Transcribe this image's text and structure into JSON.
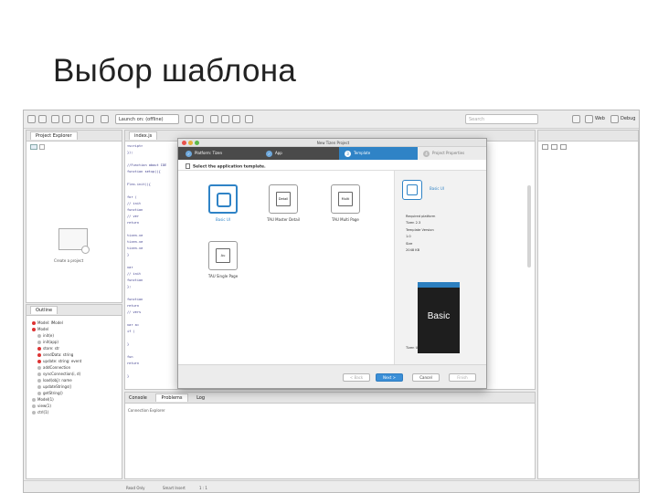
{
  "slide": {
    "title": "Выбор шаблона"
  },
  "toolbar": {
    "config_select": "Launch on: (offline)",
    "search_placeholder": "Search",
    "perspective_web": "Web",
    "perspective_debug": "Debug"
  },
  "left_panel": {
    "tab": "Project Explorer",
    "empty_label": "Create a project"
  },
  "editor": {
    "tab": "index.js",
    "lines": [
      "<script>",
      "  });",
      "",
      "//Function about IDE",
      "  function setup(){",
      "",
      "  Flex.init(){",
      "",
      "    for (",
      "      // init",
      "    function",
      "    // ver",
      "    return",
      "",
      "    tizen.ve",
      "    tizen.ve",
      "    tizen.ve",
      "  }",
      "",
      "  var",
      "    // init",
      "    function",
      "  };",
      "",
      "  function",
      "    return",
      "    // vers",
      "",
      "  var a=",
      "    if (",
      "",
      "  }",
      "",
      "  fun",
      "    return",
      "",
      "}"
    ]
  },
  "outline": {
    "tab": "Outline",
    "items": [
      {
        "label": "Model: IModel",
        "color": "#d33"
      },
      {
        "label": "Model",
        "color": "#d33"
      },
      {
        "label": "init(e)",
        "color": "#888"
      },
      {
        "label": "init(app)",
        "color": "#888"
      },
      {
        "label": "store: str",
        "color": "#d33"
      },
      {
        "label": "sendData: string",
        "color": "#d33"
      },
      {
        "label": "update: string: event",
        "color": "#d33"
      },
      {
        "label": "addConnection",
        "color": "#888"
      },
      {
        "label": "syncConnection(i, d)",
        "color": "#888"
      },
      {
        "label": "load(obj): name",
        "color": "#888"
      },
      {
        "label": "updateStrings()",
        "color": "#888"
      },
      {
        "label": "getString()",
        "color": "#888"
      },
      {
        "label": "Model(1)",
        "color": "#888"
      },
      {
        "label": "view(1)",
        "color": "#888"
      },
      {
        "label": "ctrl(1)",
        "color": "#888"
      }
    ]
  },
  "dialog": {
    "window_title": "New Tizen Project",
    "steps": [
      {
        "label": "Platform: Tizen"
      },
      {
        "label": "App"
      },
      {
        "label": "Template"
      },
      {
        "label": "Project Properties"
      }
    ],
    "subheader": "Select the application template.",
    "templates": [
      {
        "label": "Basic UI"
      },
      {
        "label": "TAU Master Detail"
      },
      {
        "label": "TAU Multi Page"
      },
      {
        "label": "TAU Single Page"
      }
    ],
    "card_text": {
      "master": "Detail",
      "multipage": "Multi",
      "singlepage": "Au"
    },
    "side": {
      "name": "Basic UI",
      "lines": [
        "Required platform",
        "Tizen 2.3",
        "Template Version",
        "1.0",
        "Size",
        "2048 KB"
      ],
      "preview": "Basic",
      "description": "Tizen UI application template"
    },
    "buttons": {
      "back": "< Back",
      "next": "Next >",
      "cancel": "Cancel",
      "finish": "Finish"
    }
  },
  "console": {
    "tabs": [
      "Console",
      "Problems",
      "Log"
    ],
    "text": "Connection Explorer"
  },
  "status": {
    "left": "Read Only",
    "middle": "Smart Insert",
    "right": "1 : 1"
  }
}
